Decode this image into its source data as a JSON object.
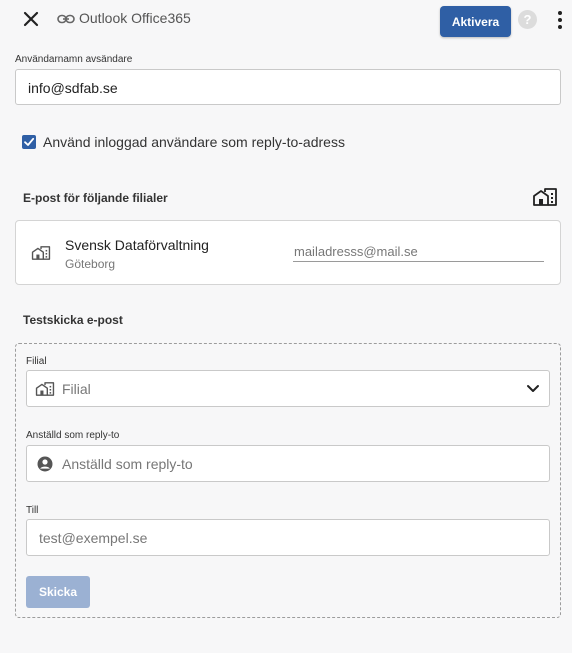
{
  "header": {
    "title": "Outlook Office365",
    "activate_label": "Aktivera",
    "help_glyph": "?"
  },
  "sender": {
    "label": "Användarnamn avsändare",
    "value": "info@sdfab.se"
  },
  "reply_to_checkbox": {
    "checked": true,
    "label": "Använd inloggad användare som reply-to-adress"
  },
  "branches": {
    "title": "E-post för följande filialer",
    "items": [
      {
        "name": "Svensk Dataförvaltning",
        "city": "Göteborg",
        "email_placeholder": "mailadresss@mail.se"
      }
    ]
  },
  "test_send": {
    "title": "Testskicka e-post",
    "branch_label": "Filial",
    "branch_placeholder": "Filial",
    "employee_label": "Anställd som reply-to",
    "employee_placeholder": "Anställd som reply-to",
    "to_label": "Till",
    "to_placeholder": "test@exempel.se",
    "send_label": "Skicka"
  },
  "colors": {
    "accent": "#2f5fa5",
    "disabled_button": "#9bb1d3",
    "background": "#f7f7f8"
  },
  "icons": [
    "close-icon",
    "link-icon",
    "help-icon",
    "more-vertical-icon",
    "check-icon",
    "building-icon",
    "chevron-down-icon",
    "user-circle-icon"
  ]
}
